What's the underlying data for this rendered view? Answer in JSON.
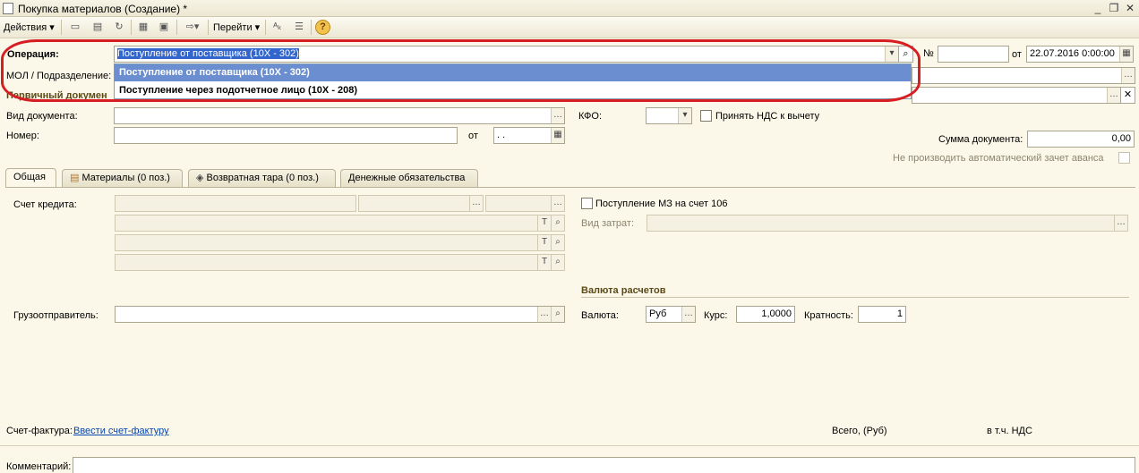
{
  "window": {
    "title": "Покупка материалов (Создание) *"
  },
  "toolbar": {
    "actions_label": "Действия",
    "goto_label": "Перейти",
    "help_label": "?"
  },
  "header": {
    "operation_label": "Операция:",
    "operation_value": "Поступление от поставщика (10Х - 302)",
    "number_suffix": "№",
    "date_label": "от",
    "date_value": "22.07.2016  0:00:00",
    "mol_label": "МОЛ / Подразделение:",
    "primary_doc_label": "Первичный докумен"
  },
  "operation_dropdown": {
    "options": [
      "Поступление от поставщика (10Х - 302)",
      "Поступление через подотчетное лицо (10Х - 208)"
    ]
  },
  "document": {
    "doc_type_label": "Вид документа:",
    "number_label": "Номер:",
    "from_label": "от",
    "date_placeholder": " .  .",
    "kfo_label": "КФО:",
    "vat_checkbox_label": "Принять НДС к вычету",
    "sum_label": "Сумма документа:",
    "sum_value": "0,00",
    "no_autooffset_label": "Не производить автоматический зачет аванса"
  },
  "tabs": [
    {
      "label": "Общая"
    },
    {
      "label": "Материалы (0 поз.)"
    },
    {
      "label": "Возвратная тара (0 поз.)"
    },
    {
      "label": "Денежные обязательства"
    }
  ],
  "general_tab": {
    "credit_account_label": "Счет кредита:",
    "mz_checkbox_label": "Поступление МЗ на счет 106",
    "expense_type_label": "Вид затрат:",
    "currency_section_title": "Валюта расчетов",
    "currency_label": "Валюта:",
    "currency_value": "Руб",
    "rate_label": "Курс:",
    "rate_value": "1,0000",
    "multiplicity_label": "Кратность:",
    "multiplicity_value": "1",
    "consignor_label": "Грузоотправитель:"
  },
  "footer": {
    "invoice_label": "Счет-фактура:",
    "invoice_link": "Ввести счет-фактуру",
    "total_label": "Всего, (Руб)",
    "vat_label": "в т.ч. НДС",
    "comment_label": "Комментарий:"
  },
  "colors": {
    "background": "#FBF8E9",
    "highlight_oval": "#D61E23",
    "dropdown_selection": "#6A8ECF",
    "section_title": "#5C4A16",
    "link": "#0645AD"
  }
}
